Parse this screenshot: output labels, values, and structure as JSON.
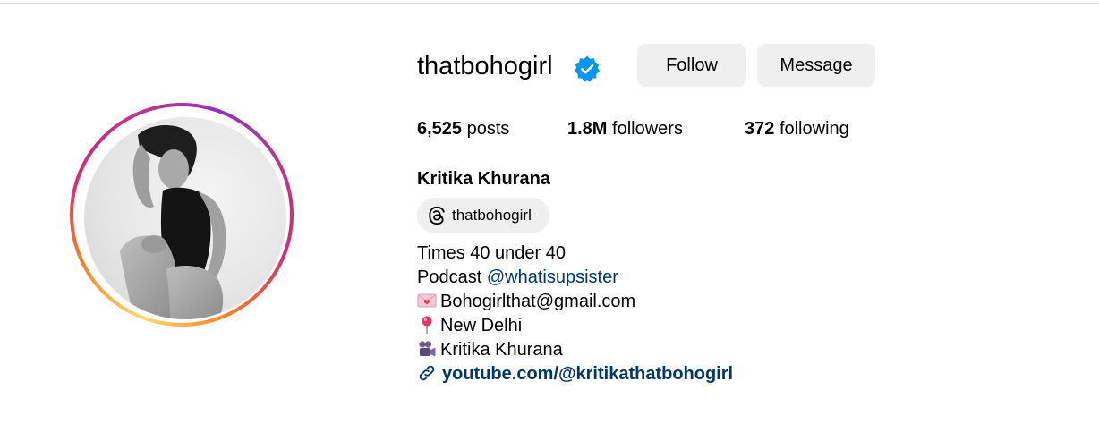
{
  "profile": {
    "username": "thatbohogirl",
    "verified": true,
    "buttons": {
      "follow": "Follow",
      "message": "Message"
    },
    "stats": {
      "posts": {
        "value": "6,525",
        "label": "posts"
      },
      "followers": {
        "value": "1.8M",
        "label": "followers"
      },
      "following": {
        "value": "372",
        "label": "following"
      }
    },
    "full_name": "Kritika Khurana",
    "threads_handle": "thatbohogirl",
    "bio": {
      "line1": "Times 40 under 40",
      "podcast_prefix": "Podcast ",
      "podcast_mention": "@whatisupsister",
      "email": "Bohogirlthat@gmail.com",
      "location": "New Delhi",
      "name_line": "Kritika Khurana",
      "link": "youtube.com/@kritikathatbohogirl"
    }
  },
  "icons": {
    "verified": "verified-badge-icon",
    "threads": "threads-icon",
    "email": "love-letter-icon",
    "location": "pushpin-icon",
    "camera": "movie-camera-icon",
    "link": "link-icon"
  },
  "colors": {
    "accent_verified": "#0095f6",
    "button_bg": "#efefef",
    "link": "#00376b"
  }
}
